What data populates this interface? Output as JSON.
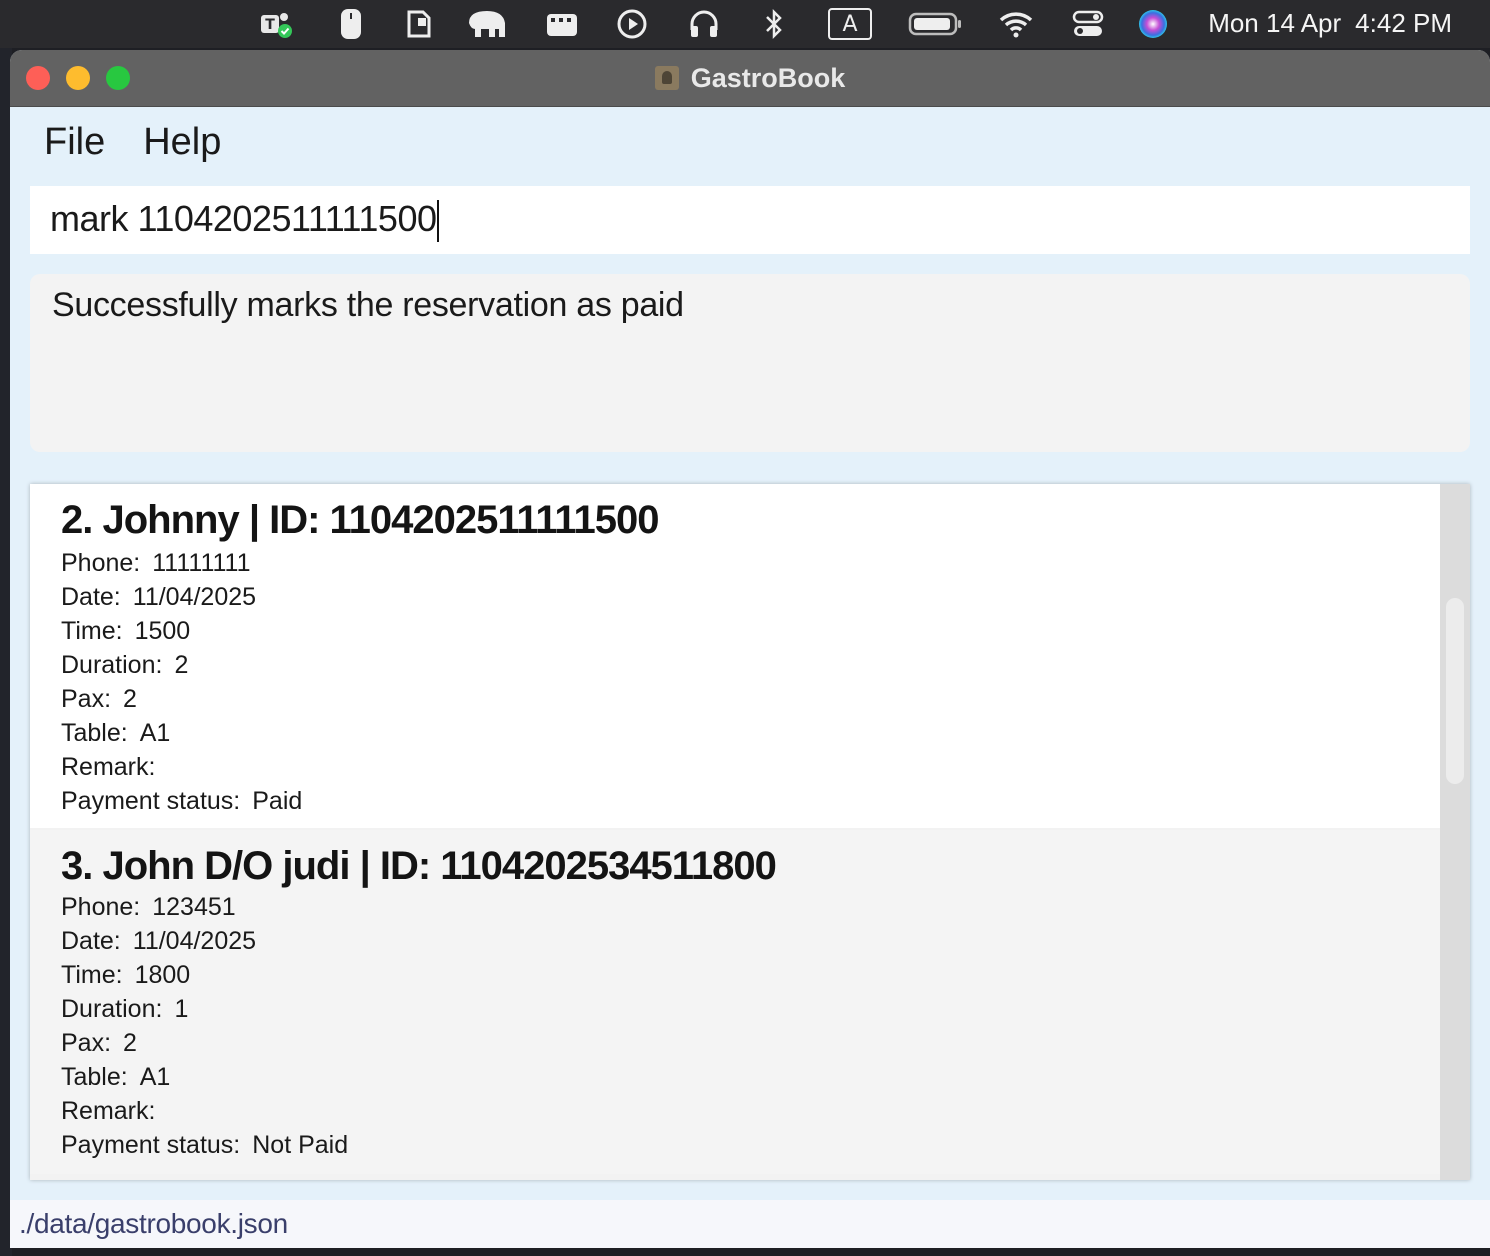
{
  "menubar": {
    "icons": [
      "teams-icon",
      "mouse-icon",
      "clipboard-icon",
      "elephant-icon",
      "clapper-icon",
      "play-icon",
      "headphones-icon",
      "bluetooth-icon",
      "input-source-icon",
      "battery-icon",
      "wifi-icon",
      "control-center-icon",
      "siri-icon"
    ],
    "input_source_label": "A",
    "date": "Mon 14 Apr",
    "time": "4:42 PM"
  },
  "window": {
    "title": "GastroBook",
    "menu": {
      "file": "File",
      "help": "Help"
    },
    "command_input": {
      "value": "mark 1104202511111500"
    },
    "result_text": "Successfully marks the reservation as paid",
    "reservations": [
      {
        "title": "2. Johnny | ID: 1104202511111500",
        "phone_label": "Phone:",
        "phone": "11111111",
        "date_label": "Date:",
        "date": "11/04/2025",
        "time_label": "Time:",
        "time": "1500",
        "duration_label": "Duration:",
        "duration": "2",
        "pax_label": "Pax:",
        "pax": "2",
        "table_label": "Table:",
        "table": "A1",
        "remark_label": "Remark:",
        "remark": "",
        "payment_label": "Payment status:",
        "payment": "Paid"
      },
      {
        "title": "3. John D/O judi | ID: 1104202534511800",
        "phone_label": "Phone:",
        "phone": "123451",
        "date_label": "Date:",
        "date": "11/04/2025",
        "time_label": "Time:",
        "time": "1800",
        "duration_label": "Duration:",
        "duration": "1",
        "pax_label": "Pax:",
        "pax": "2",
        "table_label": "Table:",
        "table": "A1",
        "remark_label": "Remark:",
        "remark": "",
        "payment_label": "Payment status:",
        "payment": "Not Paid"
      }
    ],
    "status_bar": "./data/gastrobook.json"
  },
  "colors": {
    "window_bg": "#e4f1fa",
    "titlebar": "#626262",
    "status_text": "#3a3f6b"
  }
}
